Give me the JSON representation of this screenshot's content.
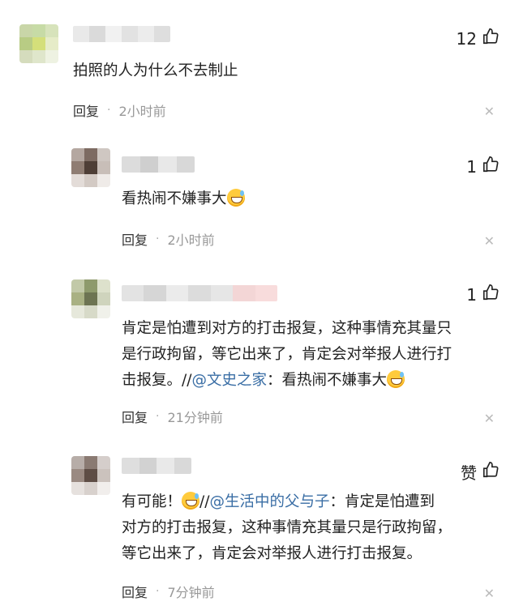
{
  "comments": [
    {
      "likes": "12",
      "lines": [
        "拍照的人为什么不去制止"
      ],
      "reply_label": "回复",
      "time": "2小时前"
    },
    {
      "likes": "1",
      "lines": [
        "看热闹不嫌事大"
      ],
      "reply_label": "回复",
      "time": "2小时前"
    },
    {
      "likes": "1",
      "line1": "肯定是怕遭到对方的打击报复，这种事情充其量只",
      "line2": "是行政拘留，等它出来了，肯定会对举报人进行打",
      "line3_prefix": "击报复。//",
      "line3_mention": "@文史之家",
      "line3_suffix": "：看热闹不嫌事大",
      "reply_label": "回复",
      "time": "21分钟前"
    },
    {
      "likes": "赞",
      "line1_prefix": "有可能！",
      "line1_sep": "//",
      "line1_mention": "@生活中的父与子",
      "line1_suffix": "：肯定是怕遭到",
      "line2": "对方的打击报复，这种事情充其量只是行政拘留，",
      "line3": "等它出来了，肯定会对举报人进行打击报复。",
      "reply_label": "回复",
      "time": "7分钟前"
    }
  ],
  "icons": {
    "like": "thumbs-up-icon",
    "close": "close-icon",
    "emoji": "grinning-sweat-emoji-icon"
  },
  "colors": {
    "mention": "#3a6ea5",
    "time": "#999999",
    "text": "#222222"
  }
}
